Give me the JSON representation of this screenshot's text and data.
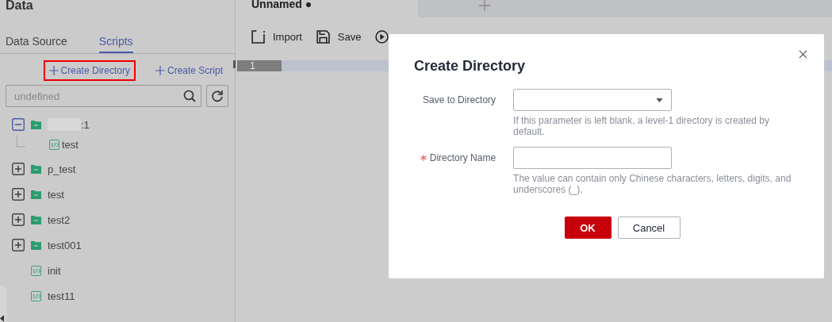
{
  "sidebar": {
    "title": "Data",
    "tabs": [
      {
        "label": "Data Source",
        "selected": false
      },
      {
        "label": "Scripts",
        "selected": true
      }
    ],
    "actions": [
      {
        "label": "Create Directory",
        "highlighted": true
      },
      {
        "label": "Create Script",
        "highlighted": false
      }
    ],
    "search": {
      "placeholder": "undefined"
    },
    "tree": [
      {
        "kind": "folder",
        "label": ":1",
        "redacted": true,
        "expanded": true,
        "children": [
          {
            "kind": "script",
            "label": "test"
          }
        ]
      },
      {
        "kind": "folder",
        "label": "p_test",
        "expanded": false
      },
      {
        "kind": "folder",
        "label": "test",
        "expanded": false
      },
      {
        "kind": "folder",
        "label": "test2",
        "expanded": false
      },
      {
        "kind": "folder",
        "label": "test001",
        "expanded": false
      },
      {
        "kind": "script",
        "label": "init"
      },
      {
        "kind": "script",
        "label": "test11"
      }
    ]
  },
  "editor": {
    "tab": {
      "label": "Unnamed",
      "modified": true
    },
    "toolbar": [
      {
        "kind": "import",
        "label": "Import"
      },
      {
        "kind": "save",
        "label": "Save"
      },
      {
        "kind": "run"
      }
    ],
    "line_numbers": [
      "1"
    ]
  },
  "dialog": {
    "title": "Create Directory",
    "fields": [
      {
        "kind": "select",
        "label": "Save to Directory",
        "required": false,
        "hint": "If this parameter is left blank, a level-1 directory is created by default."
      },
      {
        "kind": "text",
        "label": "Directory Name",
        "required": true,
        "hint": "The value can contain only Chinese characters, letters, digits, and underscores (_)."
      }
    ],
    "buttons": [
      {
        "label": "OK",
        "primary": true
      },
      {
        "label": "Cancel",
        "primary": false
      }
    ]
  }
}
